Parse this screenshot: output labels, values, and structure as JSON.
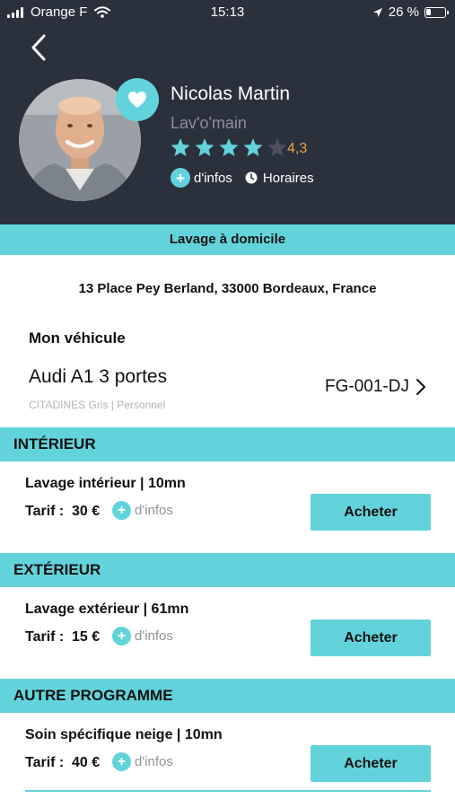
{
  "status_bar": {
    "carrier": "Orange F",
    "time": "15:13",
    "battery": "26 %"
  },
  "profile": {
    "name": "Nicolas Martin",
    "company": "Lav'o'main",
    "rating": "4,3",
    "rating_value": 4.3,
    "stars_filled": 4,
    "stars_total": 5,
    "more_info_label": "d'infos",
    "hours_label": "Horaires"
  },
  "banner": {
    "title": "Lavage à domicile"
  },
  "address": "13 Place Pey Berland, 33000 Bordeaux, France",
  "vehicle": {
    "section_title": "Mon véhicule",
    "name": "Audi A1 3 portes",
    "details": "CITADINES Gris | Personnel",
    "plate": "FG-001-DJ"
  },
  "sections": [
    {
      "title": "INTÉRIEUR",
      "service": {
        "name": "Lavage intérieur | 10mn",
        "price_label": "Tarif :",
        "price": "30 €",
        "info_label": "d'infos",
        "buy_label": "Acheter"
      }
    },
    {
      "title": "EXTÉRIEUR",
      "service": {
        "name": "Lavage extérieur | 61mn",
        "price_label": "Tarif :",
        "price": "15 €",
        "info_label": "d'infos",
        "buy_label": "Acheter"
      }
    },
    {
      "title": "AUTRE PROGRAMME",
      "service": {
        "name": "Soin spécifique neige | 10mn",
        "price_label": "Tarif :",
        "price": "40 €",
        "info_label": "d'infos",
        "buy_label": "Acheter"
      }
    }
  ],
  "colors": {
    "header_bg": "#2b303d",
    "accent": "#63d3db",
    "rating": "#e5a93a",
    "muted_text": "#8b909c",
    "star_empty": "#4a5060"
  }
}
